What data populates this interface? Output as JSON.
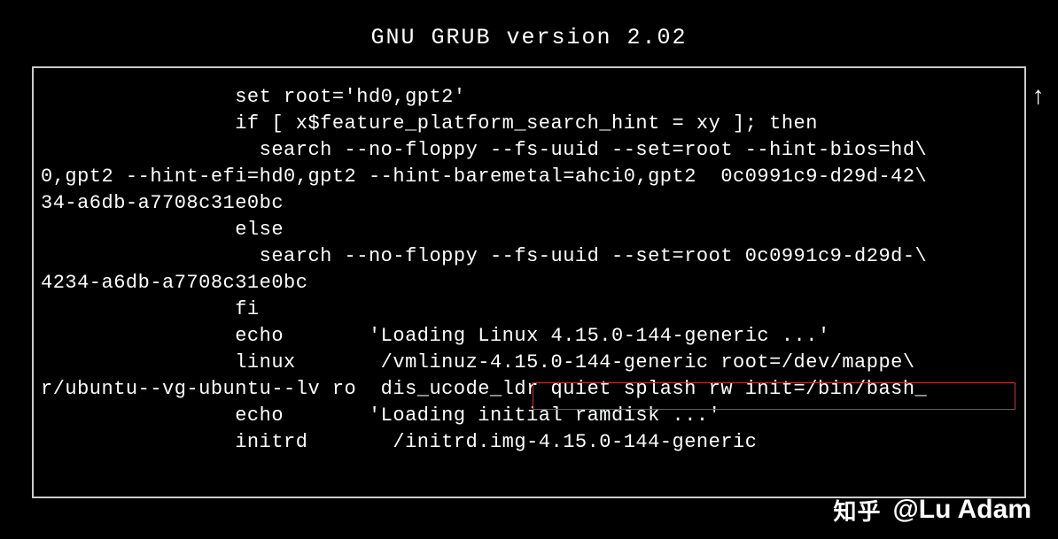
{
  "title": "GNU GRUB  version 2.02",
  "scroll_indicator": "↑",
  "lines": {
    "l1": "                set root='hd0,gpt2'",
    "l2": "                if [ x$feature_platform_search_hint = xy ]; then",
    "l3": "                  search --no-floppy --fs-uuid --set=root --hint-bios=hd\\",
    "l4": "0,gpt2 --hint-efi=hd0,gpt2 --hint-baremetal=ahci0,gpt2  0c0991c9-d29d-42\\",
    "l5": "34-a6db-a7708c31e0bc",
    "l6": "                else",
    "l7": "                  search --no-floppy --fs-uuid --set=root 0c0991c9-d29d-\\",
    "l8": "4234-a6db-a7708c31e0bc",
    "l9": "                fi",
    "l10": "                echo       'Loading Linux 4.15.0-144-generic ...'",
    "l11": "                linux       /vmlinuz-4.15.0-144-generic root=/dev/mappe\\",
    "l12": "r/ubuntu--vg-ubuntu--lv ro  dis_ucode_ldr quiet splash rw init=/bin/bash_",
    "l13": "                echo       'Loading initial ramdisk ...'",
    "l14": "                initrd       /initrd.img-4.15.0-144-generic"
  },
  "highlighted_fragment": "quiet splash rw init=/bin/bash",
  "watermark": {
    "platform": "知乎",
    "author": "@Lu Adam"
  }
}
